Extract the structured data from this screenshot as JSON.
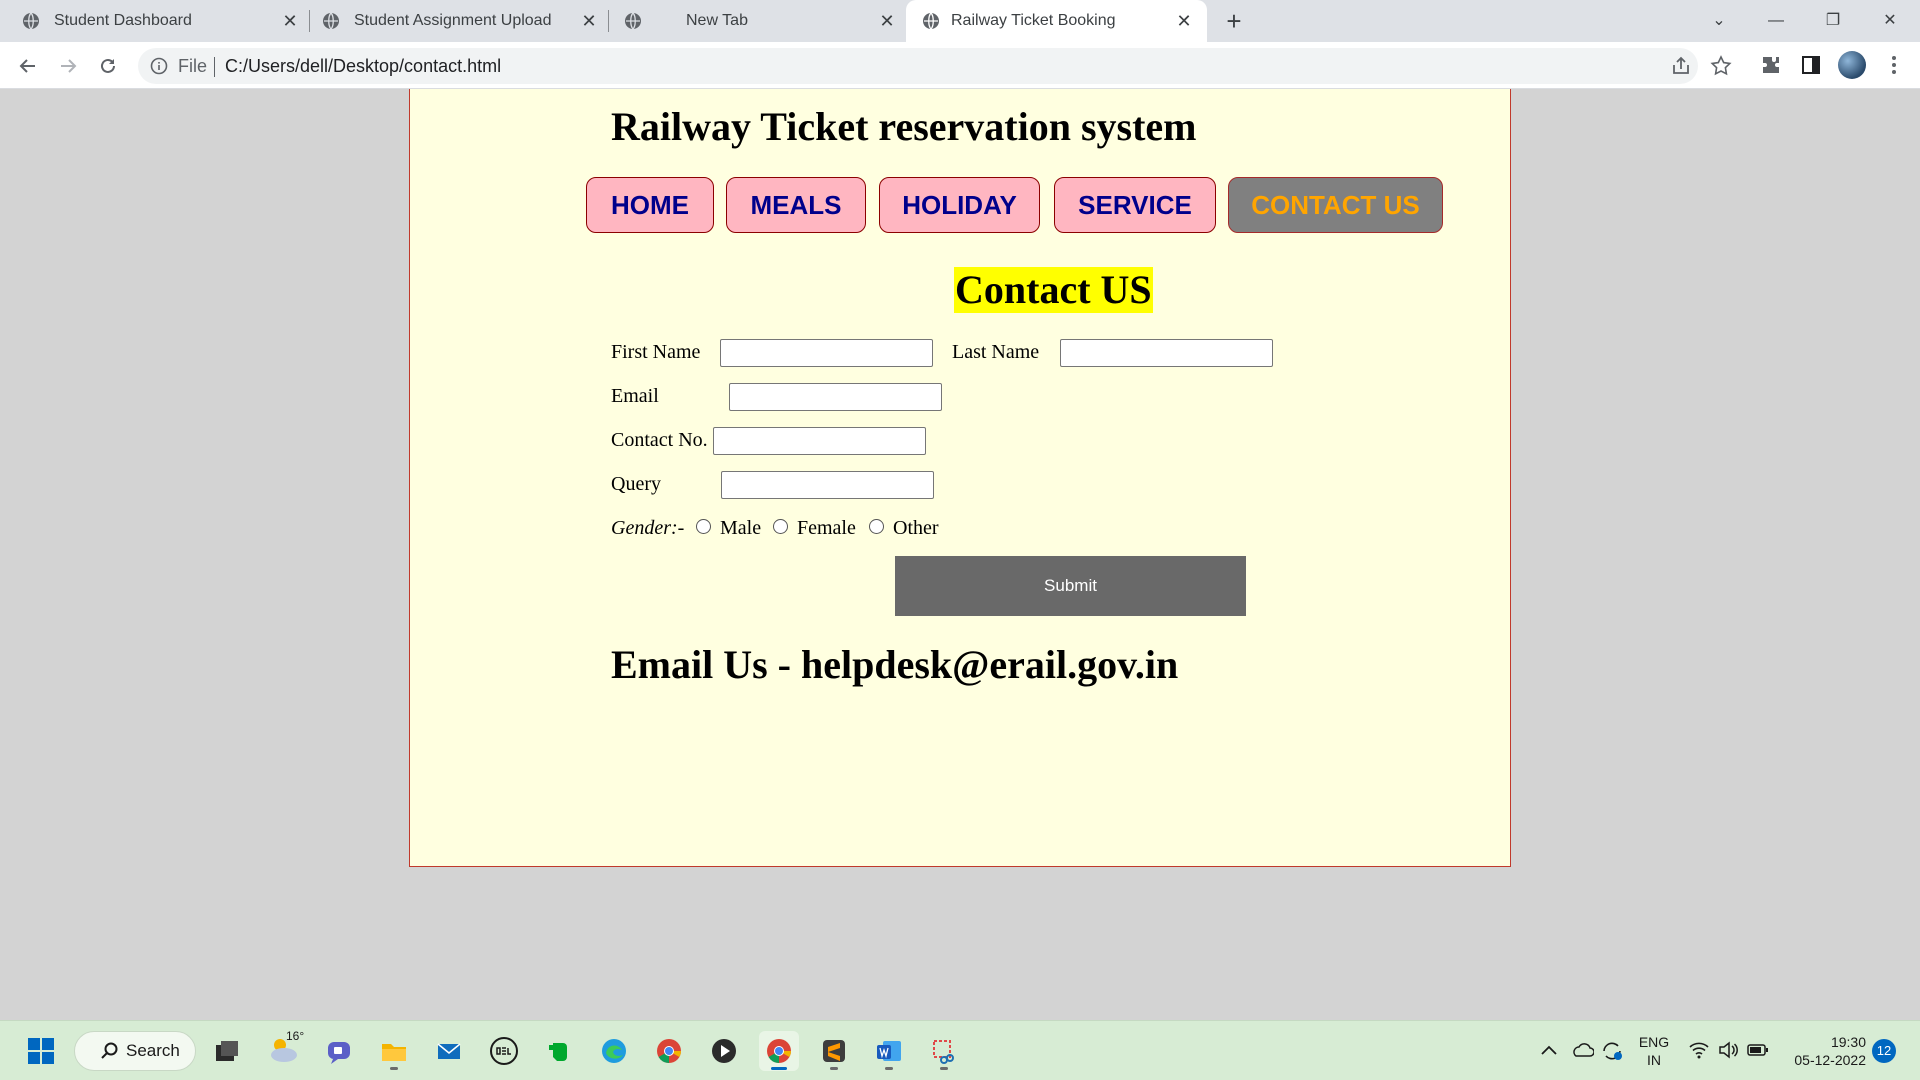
{
  "browser": {
    "tabs": [
      {
        "title": "Student Dashboard",
        "close": "✕"
      },
      {
        "title": "Student Assignment Upload",
        "close": "✕"
      },
      {
        "title": "New Tab",
        "close": "✕"
      },
      {
        "title": "Railway Ticket Booking",
        "close": "✕",
        "active": true
      }
    ],
    "new_tab": "+",
    "window_controls": {
      "dropdown": "⌄",
      "minimize": "—",
      "restore": "❐",
      "close": "✕"
    },
    "address": {
      "scheme_label": "File",
      "url": "C:/Users/dell/Desktop/contact.html"
    }
  },
  "page": {
    "site_title": "Railway Ticket reservation system",
    "nav": [
      "HOME",
      "MEALS",
      "HOLIDAY",
      "SERVICE",
      "CONTACT US"
    ],
    "active_nav": "CONTACT US",
    "contact_heading": "Contact US",
    "form": {
      "first_name_label": "First Name",
      "last_name_label": "Last Name",
      "email_label": "Email",
      "contact_label": "Contact No.",
      "query_label": "Query",
      "gender_label": "Gender:-",
      "gender_options": [
        "Male",
        "Female",
        "Other"
      ],
      "submit_label": "Submit"
    },
    "email_us": "Email Us - helpdesk@erail.gov.in"
  },
  "taskbar": {
    "search_label": "Search",
    "weather_temp": "16°",
    "lang_primary": "ENG",
    "lang_secondary": "IN",
    "time": "19:30",
    "date": "05-12-2022",
    "notification_count": "12"
  },
  "colors": {
    "page_bg": "#ffffe0",
    "nav_button": "#ffb6c1",
    "nav_text": "#00008b",
    "active_nav_bg": "#808080",
    "active_nav_text": "#ffa500",
    "heading_highlight": "#ffff00",
    "submit_bg": "#696969",
    "frame_border": "#c0392b"
  }
}
